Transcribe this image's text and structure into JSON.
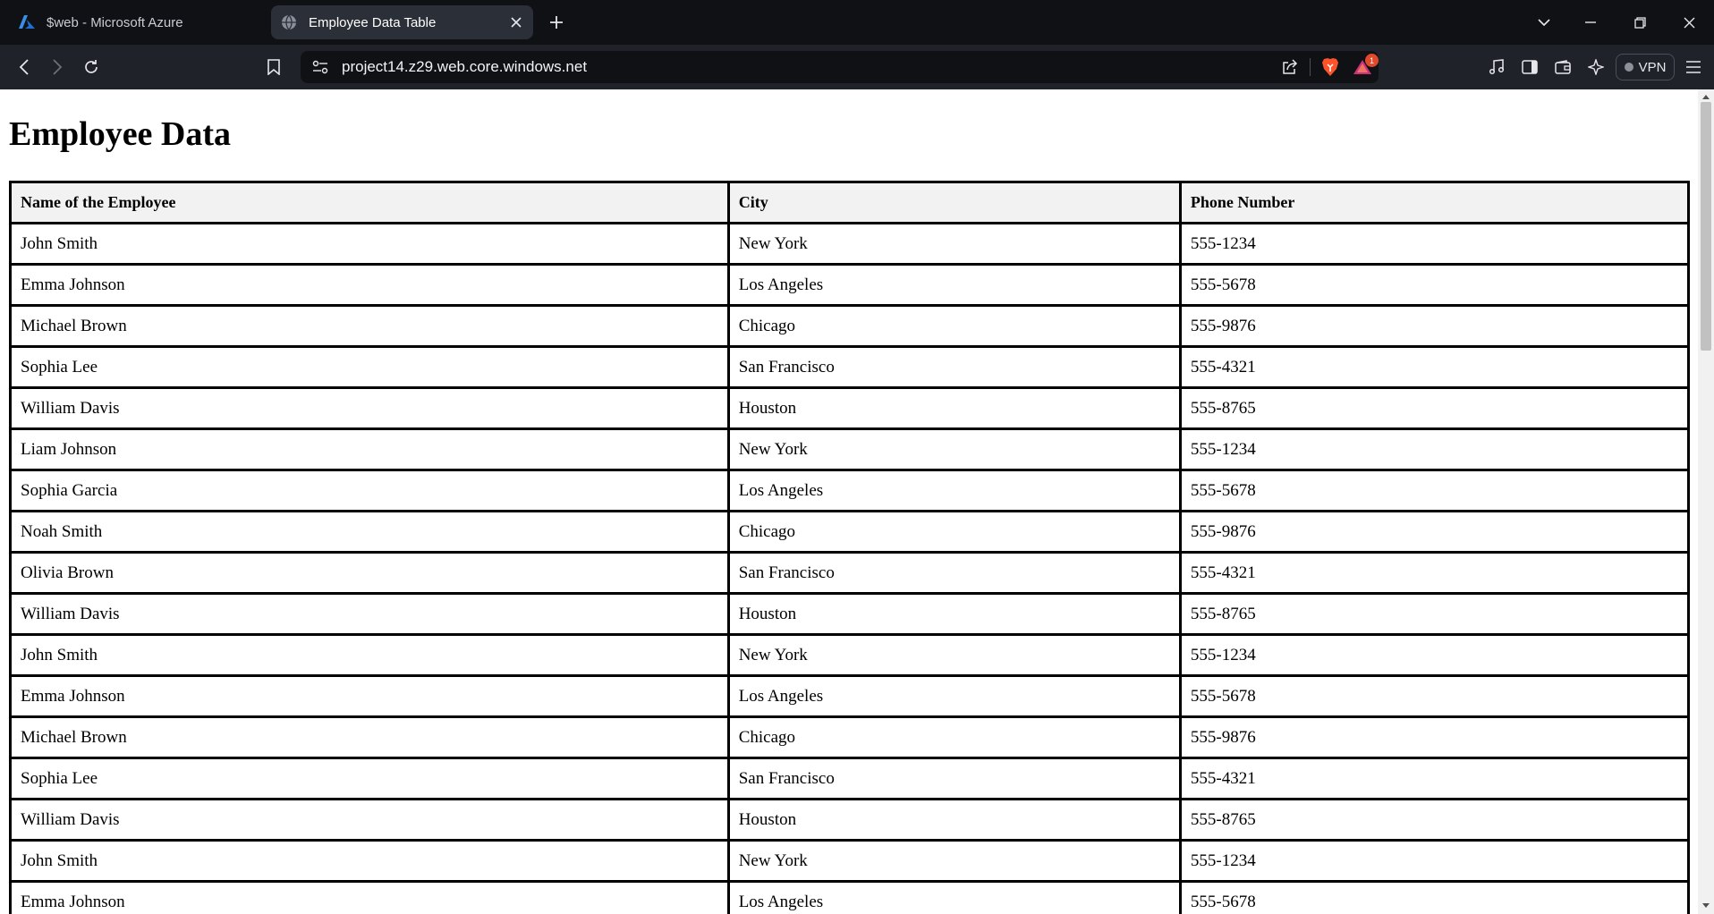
{
  "tabs": [
    {
      "title": "$web - Microsoft Azure",
      "active": false,
      "icon": "azure-logo-icon"
    },
    {
      "title": "Employee Data Table",
      "active": true,
      "icon": "globe-icon"
    }
  ],
  "address_bar": {
    "url": "project14.z29.web.core.windows.net"
  },
  "toolbar": {
    "vpn_label": "VPN",
    "notification_count": "1"
  },
  "colors": {
    "tabbar_bg": "#0f1115",
    "toolbar_bg": "#1f2229",
    "brave_orange": "#fb542b",
    "header_bg": "#f2f2f2"
  },
  "page": {
    "title": "Employee Data",
    "columns": [
      "Name of the Employee",
      "City",
      "Phone Number"
    ],
    "rows": [
      [
        "John Smith",
        "New York",
        "555-1234"
      ],
      [
        "Emma Johnson",
        "Los Angeles",
        "555-5678"
      ],
      [
        "Michael Brown",
        "Chicago",
        "555-9876"
      ],
      [
        "Sophia Lee",
        "San Francisco",
        "555-4321"
      ],
      [
        "William Davis",
        "Houston",
        "555-8765"
      ],
      [
        "Liam Johnson",
        "New York",
        "555-1234"
      ],
      [
        "Sophia Garcia",
        "Los Angeles",
        "555-5678"
      ],
      [
        "Noah Smith",
        "Chicago",
        "555-9876"
      ],
      [
        "Olivia Brown",
        "San Francisco",
        "555-4321"
      ],
      [
        "William Davis",
        "Houston",
        "555-8765"
      ],
      [
        "John Smith",
        "New York",
        "555-1234"
      ],
      [
        "Emma Johnson",
        "Los Angeles",
        "555-5678"
      ],
      [
        "Michael Brown",
        "Chicago",
        "555-9876"
      ],
      [
        "Sophia Lee",
        "San Francisco",
        "555-4321"
      ],
      [
        "William Davis",
        "Houston",
        "555-8765"
      ],
      [
        "John Smith",
        "New York",
        "555-1234"
      ],
      [
        "Emma Johnson",
        "Los Angeles",
        "555-5678"
      ]
    ]
  }
}
